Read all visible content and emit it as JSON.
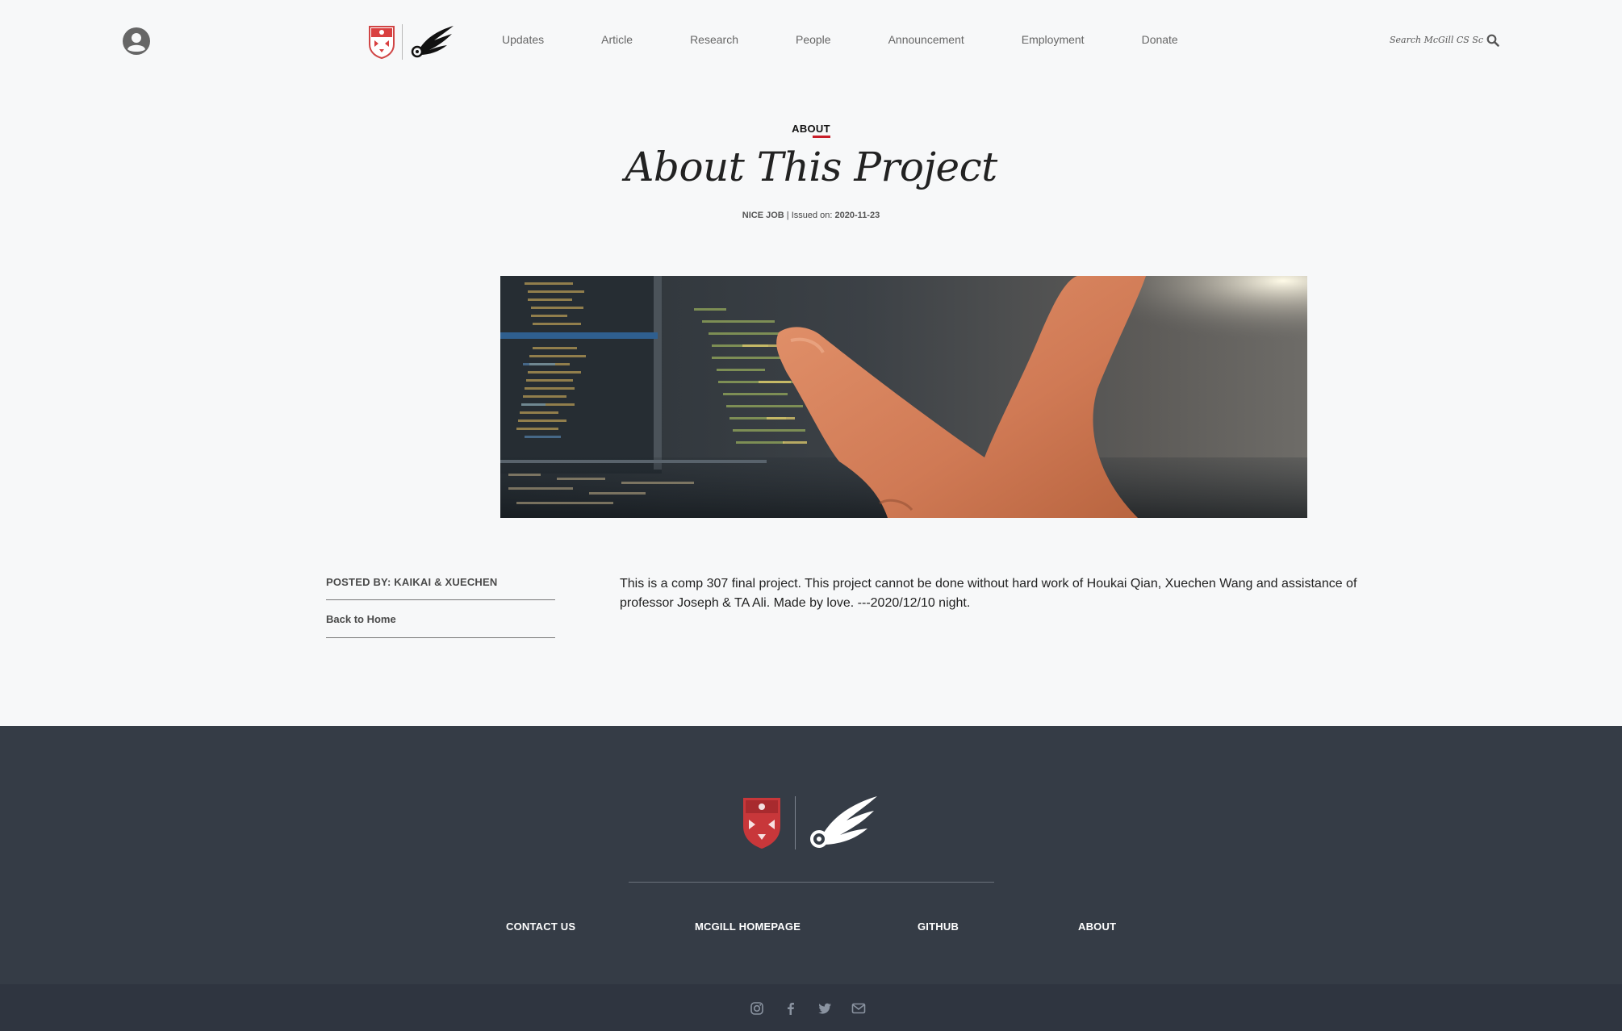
{
  "header": {
    "nav": [
      "Updates",
      "Article",
      "Research",
      "People",
      "Announcement",
      "Employment",
      "Donate"
    ],
    "search_placeholder": "Search McGill CS School"
  },
  "article": {
    "kicker": "ABOUT",
    "title": "About This Project",
    "meta": {
      "author": "NICE JOB",
      "separator": " | Issued on: ",
      "date": "2020-11-23"
    },
    "posted_by": "POSTED BY: KAIKAI & XUECHEN",
    "back_link": "Back to Home",
    "body": "This is a comp 307 final project. This project cannot be done without hard work of Houkai Qian, Xuechen Wang and assistance of professor Joseph & TA Ali. Made by love. ---2020/12/10 night."
  },
  "footer": {
    "links": [
      "CONTACT US",
      "MCGILL HOMEPAGE",
      "GITHUB",
      "ABOUT"
    ],
    "social_icons": [
      "instagram-icon",
      "facebook-icon",
      "twitter-icon",
      "mail-icon"
    ]
  },
  "colors": {
    "page_bg": "#f7f8f9",
    "accent_red": "#c81e2a",
    "footer_bg": "#353c46",
    "footer_bottom_bg": "#2f3540"
  }
}
